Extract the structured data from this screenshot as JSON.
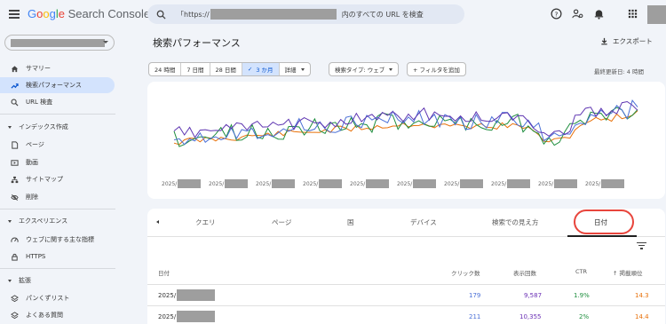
{
  "app": {
    "brand_google": [
      "G",
      "o",
      "o",
      "g",
      "l",
      "e"
    ],
    "brand_rest": " Search Console"
  },
  "search": {
    "prefix": "「https://",
    "suffix": "内のすべての URL を検査"
  },
  "sidebar": {
    "items": [
      {
        "label": "サマリー",
        "icon": "home-icon"
      },
      {
        "label": "検索パフォーマンス",
        "icon": "trending-up-icon",
        "active": true
      },
      {
        "label": "URL 検査",
        "icon": "search-icon"
      }
    ],
    "sections": [
      {
        "label": "インデックス作成",
        "items": [
          {
            "label": "ページ",
            "icon": "page-icon"
          },
          {
            "label": "動画",
            "icon": "video-icon"
          },
          {
            "label": "サイトマップ",
            "icon": "sitemap-icon"
          },
          {
            "label": "削除",
            "icon": "eye-off-icon"
          }
        ]
      },
      {
        "label": "エクスペリエンス",
        "items": [
          {
            "label": "ウェブに関する主な指標",
            "icon": "speed-icon"
          },
          {
            "label": "HTTPS",
            "icon": "lock-icon"
          }
        ]
      },
      {
        "label": "拡張",
        "items": [
          {
            "label": "パンくずリスト",
            "icon": "layers-icon"
          },
          {
            "label": "よくある質問",
            "icon": "layers-icon"
          }
        ]
      }
    ]
  },
  "main": {
    "title": "検索パフォーマンス",
    "export_label": "エクスポート",
    "date_ranges": [
      "24 時間",
      "7 日間",
      "28 日間",
      "3 か月",
      "詳細"
    ],
    "selected_range": "3 か月",
    "search_type_label": "検索タイプ: ウェブ",
    "add_filter_label": "+ フィルタを追加",
    "last_updated": "最終更新日: 4 時間"
  },
  "chart": {
    "x_tick_prefix": "2025/",
    "colors": {
      "clicks": "#4a6fd6",
      "impressions": "#5e35b1",
      "ctr": "#1e8e3e",
      "position": "#e8710a"
    }
  },
  "table": {
    "tabs": [
      "クエリ",
      "ページ",
      "国",
      "デバイス",
      "検索での見え方",
      "日付"
    ],
    "active_tab": "日付",
    "headers": {
      "date": "日付",
      "clicks": "クリック数",
      "impressions": "表示回数",
      "ctr": "CTR",
      "position": "掲載順位"
    },
    "rows": [
      {
        "date_prefix": "2025/",
        "clicks": "179",
        "impressions": "9,587",
        "ctr": "1.9%",
        "position": "14.3"
      },
      {
        "date_prefix": "2025/",
        "clicks": "211",
        "impressions": "10,355",
        "ctr": "2%",
        "position": "14.4"
      }
    ]
  }
}
